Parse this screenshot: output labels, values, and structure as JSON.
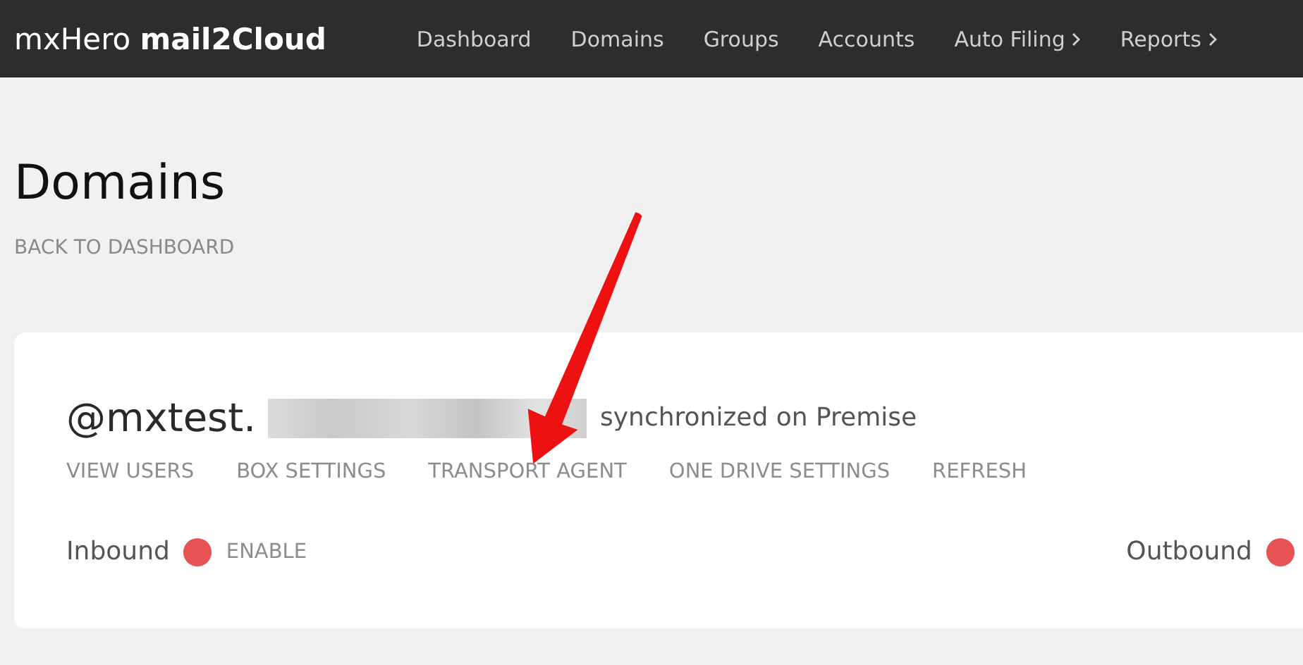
{
  "brand": {
    "prefix": "mxHero",
    "name": "mail2Cloud"
  },
  "nav": [
    {
      "label": "Dashboard",
      "submenu": false
    },
    {
      "label": "Domains",
      "submenu": false
    },
    {
      "label": "Groups",
      "submenu": false
    },
    {
      "label": "Accounts",
      "submenu": false
    },
    {
      "label": "Auto Filing",
      "submenu": true
    },
    {
      "label": "Reports",
      "submenu": true
    }
  ],
  "page_title": "Domains",
  "back_link": "BACK TO DASHBOARD",
  "domain": {
    "name": "@mxtest.",
    "status": "synchronized on Premise"
  },
  "actions": [
    "VIEW USERS",
    "BOX SETTINGS",
    "TRANSPORT AGENT",
    "ONE DRIVE SETTINGS",
    "REFRESH"
  ],
  "directions": [
    {
      "label": "Inbound",
      "enabled": false,
      "action": "ENABLE"
    },
    {
      "label": "Outbound",
      "enabled": false
    }
  ]
}
